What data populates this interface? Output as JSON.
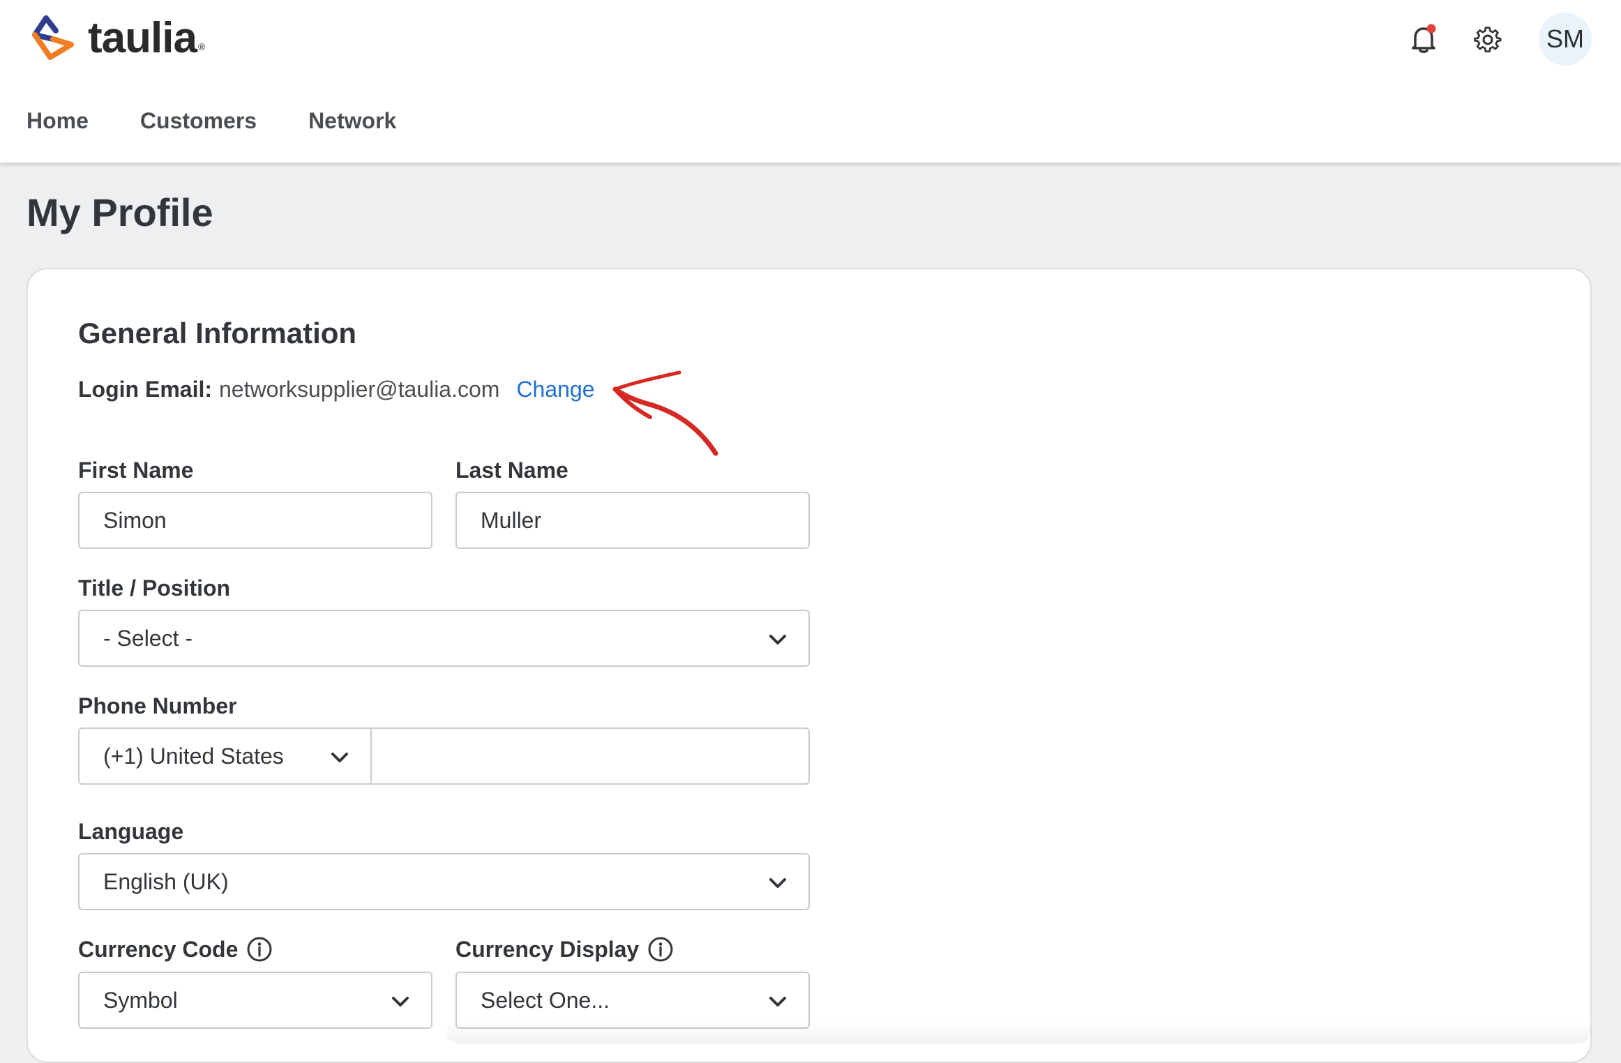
{
  "brand": {
    "name": "taulia",
    "registered_mark": "®"
  },
  "header": {
    "notifications_icon": "bell-icon",
    "settings_icon": "gear-icon",
    "avatar_initials": "SM",
    "notification_dot_color": "#e0413a"
  },
  "nav": {
    "items": [
      {
        "label": "Home"
      },
      {
        "label": "Customers"
      },
      {
        "label": "Network"
      }
    ]
  },
  "page": {
    "title": "My Profile"
  },
  "general": {
    "section_title": "General Information",
    "login_email_label": "Login Email:",
    "login_email_value": "networksupplier@taulia.com",
    "change_link": "Change",
    "annotation_color": "#d42a23"
  },
  "form": {
    "first_name": {
      "label": "First Name",
      "value": "Simon"
    },
    "last_name": {
      "label": "Last Name",
      "value": "Muller"
    },
    "title_position": {
      "label": "Title / Position",
      "value": "- Select -"
    },
    "phone": {
      "label": "Phone Number",
      "country": "(+1) United States",
      "number": ""
    },
    "language": {
      "label": "Language",
      "value": "English (UK)"
    },
    "currency_code": {
      "label": "Currency Code",
      "value": "Symbol"
    },
    "currency_display": {
      "label": "Currency Display",
      "value": "Select One..."
    }
  },
  "colors": {
    "link": "#1f6fd1",
    "background": "#eeeff1",
    "text": "#32363a"
  }
}
